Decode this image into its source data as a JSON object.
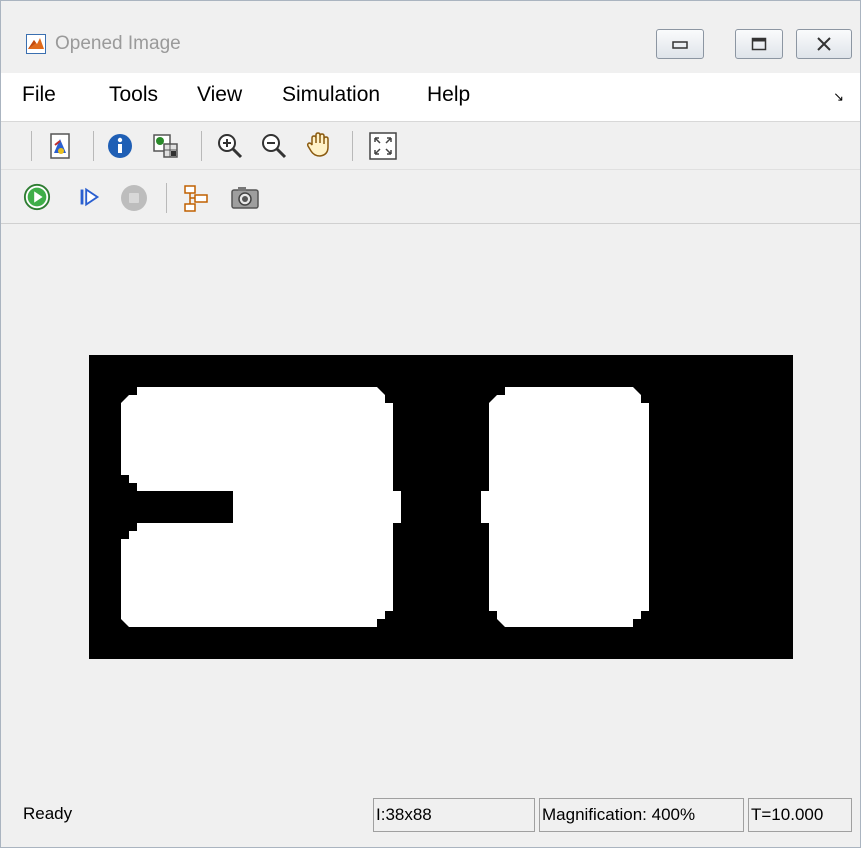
{
  "window": {
    "title": "Opened Image"
  },
  "menu": {
    "items": [
      "File",
      "Tools",
      "View",
      "Simulation",
      "Help"
    ],
    "overflow_arrow": "↘"
  },
  "toolbar1": {
    "icons": [
      "export-to-workspace-icon",
      "image-info-icon",
      "pixel-region-icon",
      "zoom-in-icon",
      "zoom-out-icon",
      "pan-hand-icon",
      "fit-to-window-icon"
    ]
  },
  "toolbar2": {
    "icons": [
      "start-simulation-icon",
      "step-forward-icon",
      "stop-simulation-icon",
      "highlight-model-icon",
      "snapshot-icon"
    ]
  },
  "status": {
    "ready": "Ready",
    "dimensions": "I:38x88",
    "magnification": "Magnification: 400%",
    "time": "T=10.000"
  },
  "colors": {
    "background": "#f0f0f0",
    "image_background": "#000000",
    "image_foreground": "#ffffff",
    "title_text": "#9a9a9a"
  }
}
